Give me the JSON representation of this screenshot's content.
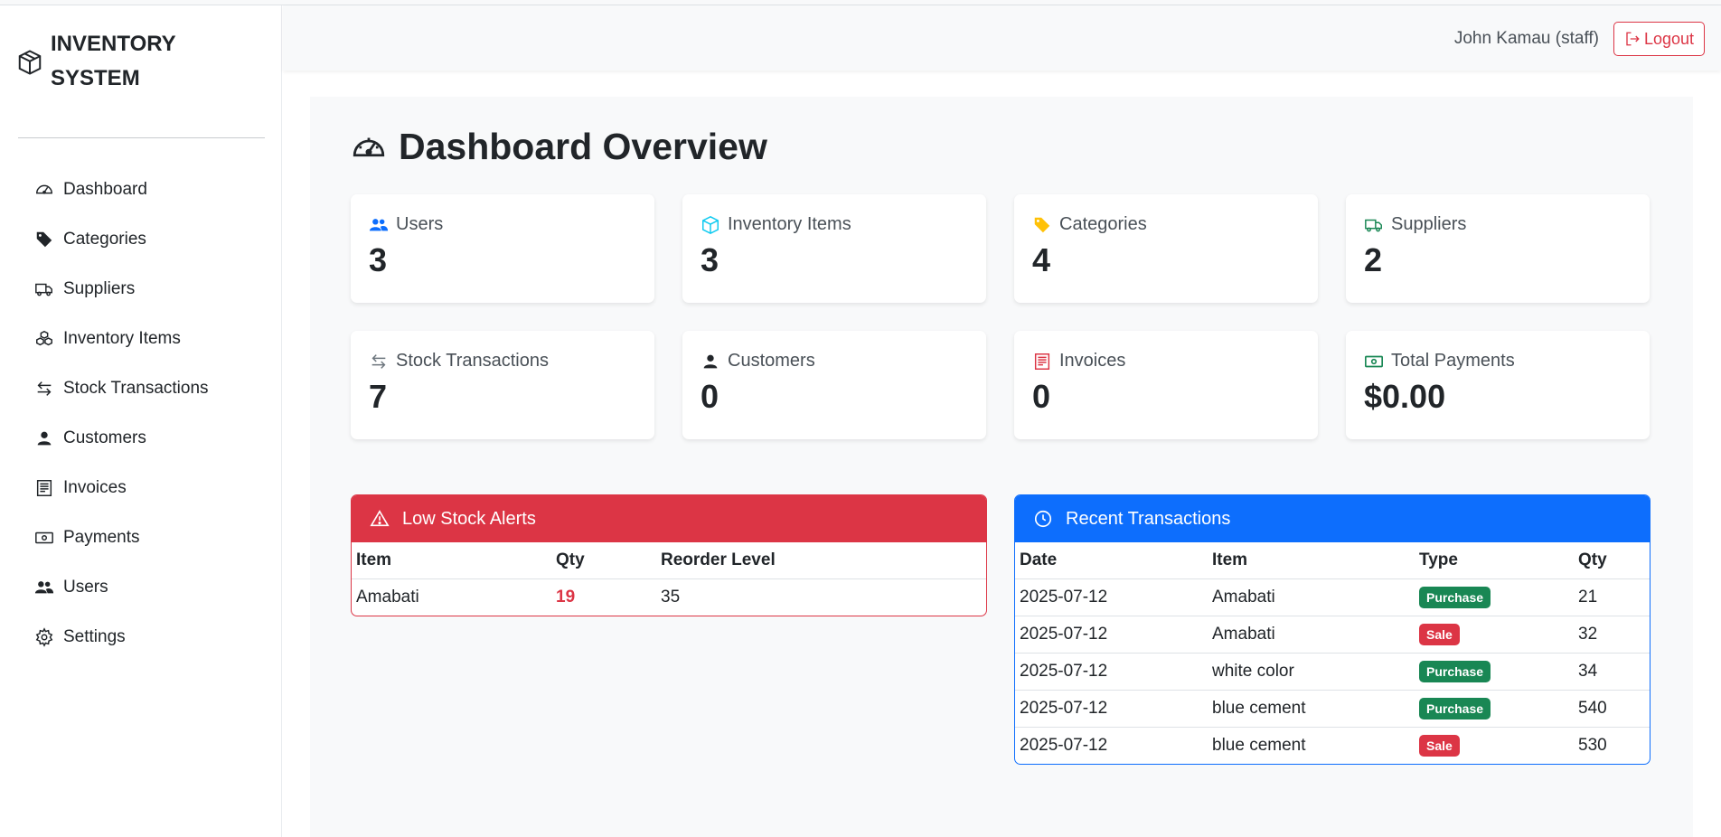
{
  "brand": {
    "title": "INVENTORY SYSTEM"
  },
  "sidebar": {
    "items": [
      {
        "label": "Dashboard",
        "icon": "speedometer-icon"
      },
      {
        "label": "Categories",
        "icon": "tags-icon"
      },
      {
        "label": "Suppliers",
        "icon": "truck-icon"
      },
      {
        "label": "Inventory Items",
        "icon": "boxes-icon"
      },
      {
        "label": "Stock Transactions",
        "icon": "arrow-left-right-icon"
      },
      {
        "label": "Customers",
        "icon": "person-icon"
      },
      {
        "label": "Invoices",
        "icon": "receipt-icon"
      },
      {
        "label": "Payments",
        "icon": "cash-icon"
      },
      {
        "label": "Users",
        "icon": "people-icon"
      },
      {
        "label": "Settings",
        "icon": "gear-icon"
      }
    ]
  },
  "header": {
    "user": "John Kamau (staff)",
    "logout_label": "Logout"
  },
  "main": {
    "title": "Dashboard Overview",
    "stats": [
      {
        "label": "Users",
        "value": "3",
        "icon": "people-icon",
        "color": "#0d6efd"
      },
      {
        "label": "Inventory Items",
        "value": "3",
        "icon": "box-icon",
        "color": "#0dcaf0"
      },
      {
        "label": "Categories",
        "value": "4",
        "icon": "tags-icon",
        "color": "#ffc107"
      },
      {
        "label": "Suppliers",
        "value": "2",
        "icon": "truck-icon",
        "color": "#198754"
      },
      {
        "label": "Stock Transactions",
        "value": "7",
        "icon": "arrow-left-right-icon",
        "color": "#6c757d"
      },
      {
        "label": "Customers",
        "value": "0",
        "icon": "person-icon",
        "color": "#212529"
      },
      {
        "label": "Invoices",
        "value": "0",
        "icon": "receipt-icon",
        "color": "#dc3545"
      },
      {
        "label": "Total Payments",
        "value": "$0.00",
        "icon": "cash-icon",
        "color": "#198754"
      }
    ]
  },
  "low_stock": {
    "title": "Low Stock Alerts",
    "color": "#dc3545",
    "columns": [
      "Item",
      "Qty",
      "Reorder Level"
    ],
    "rows": [
      {
        "item": "Amabati",
        "qty": "19",
        "reorder": "35"
      }
    ]
  },
  "recent": {
    "title": "Recent Transactions",
    "color": "#0d6efd",
    "columns": [
      "Date",
      "Item",
      "Type",
      "Qty"
    ],
    "rows": [
      {
        "date": "2025-07-12",
        "item": "Amabati",
        "type": "Purchase",
        "qty": "21"
      },
      {
        "date": "2025-07-12",
        "item": "Amabati",
        "type": "Sale",
        "qty": "32"
      },
      {
        "date": "2025-07-12",
        "item": "white color",
        "type": "Purchase",
        "qty": "34"
      },
      {
        "date": "2025-07-12",
        "item": "blue cement",
        "type": "Purchase",
        "qty": "540"
      },
      {
        "date": "2025-07-12",
        "item": "blue cement",
        "type": "Sale",
        "qty": "530"
      }
    ],
    "type_colors": {
      "Purchase": "#198754",
      "Sale": "#dc3545"
    }
  }
}
